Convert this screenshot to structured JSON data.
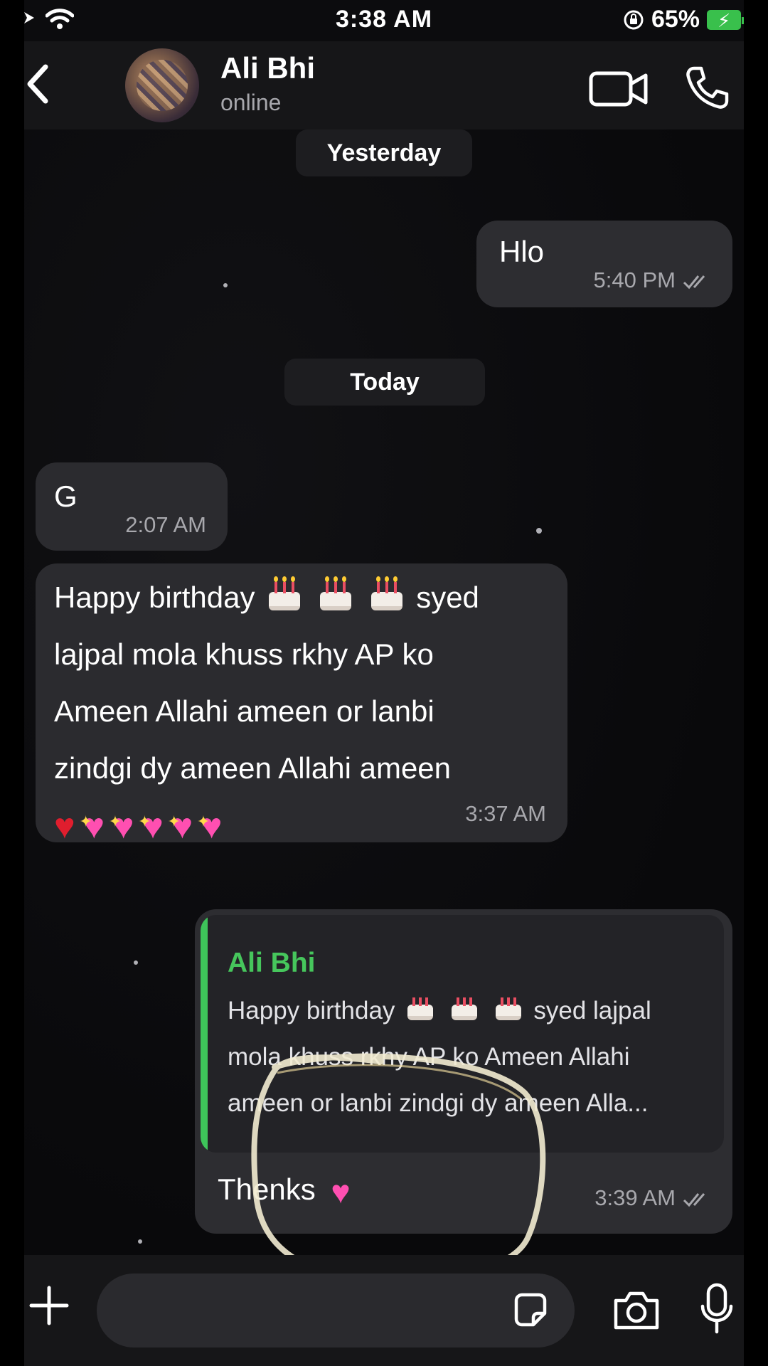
{
  "status_bar": {
    "time": "3:38 AM",
    "battery_percent": "65%",
    "battery_level": 0.65,
    "battery_color": "#39c04c"
  },
  "header": {
    "contact_name": "Ali Bhi",
    "contact_status": "online",
    "icons": [
      "back-chevron-icon",
      "video-camera-icon",
      "phone-icon"
    ]
  },
  "chat": {
    "date_yesterday": "Yesterday",
    "date_today": "Today",
    "messages": [
      {
        "direction": "out",
        "text": "Hlo",
        "time": "5:40 PM",
        "status": "read"
      },
      {
        "direction": "in",
        "text": "G",
        "time": "2:07 AM"
      },
      {
        "direction": "in",
        "line1_pre": "Happy birthday",
        "line1_post": "syed",
        "line2": "lajpal mola khuss rkhy AP ko",
        "line3": "Ameen Allahi ameen or lanbi",
        "line4": "zindgi dy ameen Allahi ameen",
        "emojis": [
          "birthday-cake",
          "birthday-cake",
          "birthday-cake",
          "red-heart",
          "sparkling-heart",
          "sparkling-heart",
          "sparkling-heart",
          "sparkling-heart",
          "sparkling-heart"
        ],
        "time": "3:37 AM"
      },
      {
        "direction": "out",
        "reply_to_name": "Ali Bhi",
        "reply_line1_pre": "Happy birthday",
        "reply_line1_post": "syed lajpal",
        "reply_line2": "mola khuss rkhy AP ko Ameen Allahi",
        "reply_line3": "ameen or lanbi zindgi dy ameen Alla...",
        "text": "Thenks",
        "emoji": "growing-heart",
        "time": "3:39 AM",
        "status": "read"
      }
    ]
  },
  "composer": {
    "placeholder": "",
    "icons": [
      "plus-icon",
      "sticker-icon",
      "camera-icon",
      "microphone-icon"
    ]
  },
  "colors": {
    "accent_green": "#46c65c",
    "bubble": "#2b2b2f",
    "background": "#0c0c0e",
    "annotation_scribble": "#f3ecd2"
  }
}
